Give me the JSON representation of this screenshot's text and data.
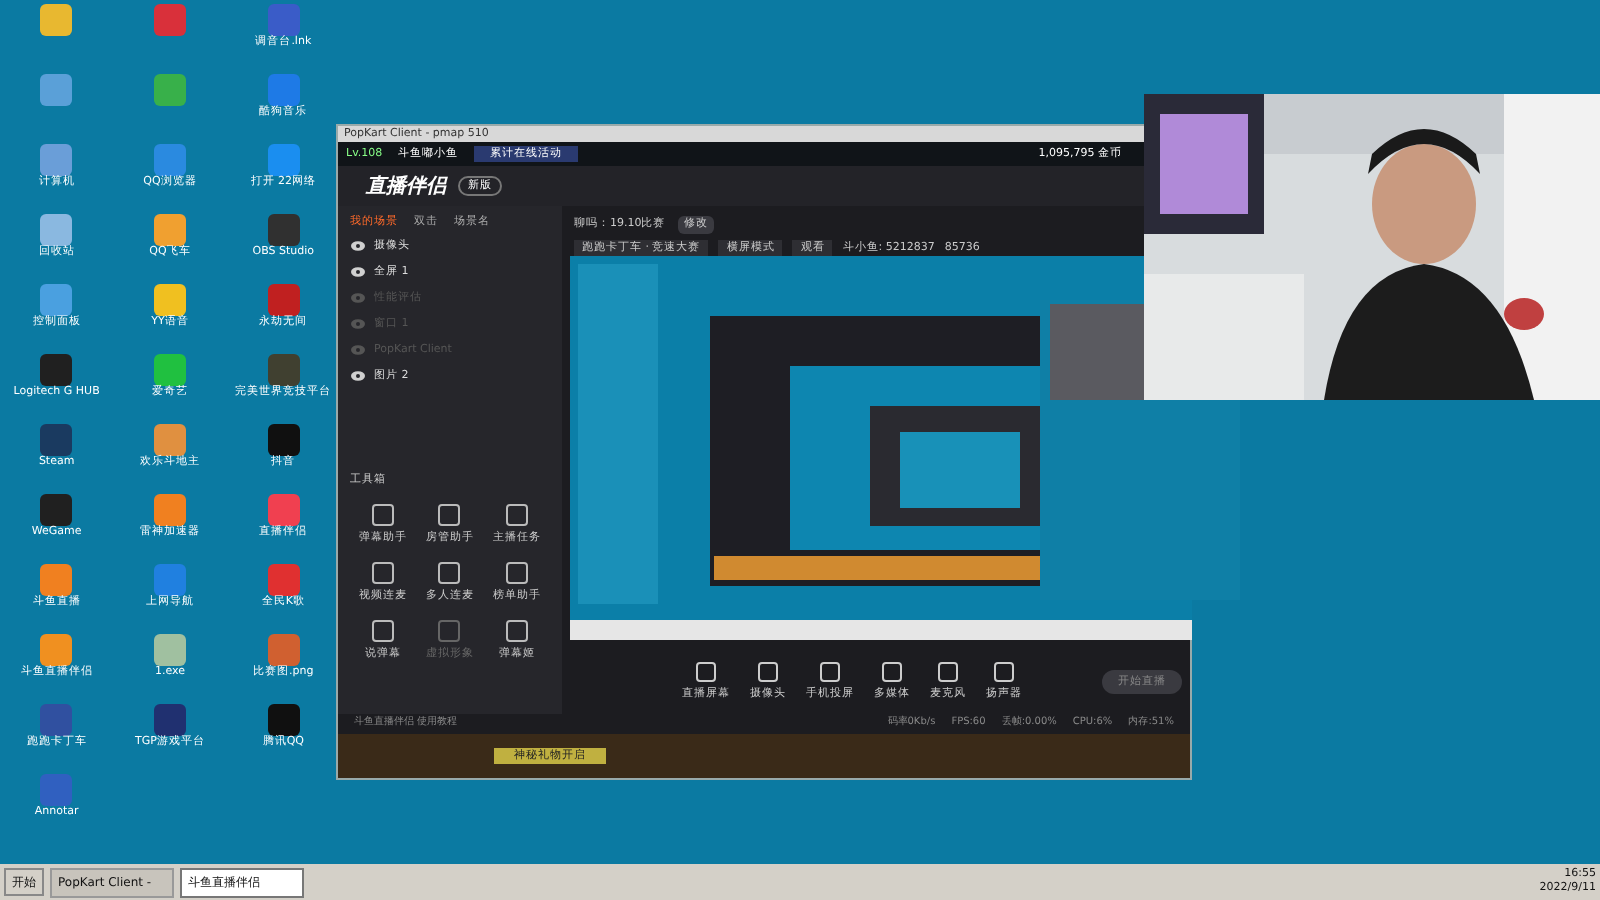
{
  "desktop_icons": [
    {
      "color": "#e8b830"
    },
    {
      "color": "#d9303a"
    },
    {
      "label": "调音台.lnk",
      "color": "#3a5cc8"
    },
    {
      "color": "#5aa0d8"
    },
    {
      "color": "#38b04a"
    },
    {
      "label": "酷狗音乐",
      "color": "#1e7ae6"
    },
    {
      "label": "计算机",
      "color": "#6a9ed8"
    },
    {
      "label": "QQ浏览器",
      "color": "#2a8ae0"
    },
    {
      "label": "打开 22网络",
      "color": "#1a8ef0"
    },
    {
      "label": "回收站",
      "color": "#8ab8e0"
    },
    {
      "label": "QQ飞车",
      "color": "#f0a030"
    },
    {
      "label": "OBS Studio",
      "color": "#303030"
    },
    {
      "label": "控制面板",
      "color": "#4aa0e0"
    },
    {
      "label": "YY语音",
      "color": "#f0c020"
    },
    {
      "label": "永劫无间",
      "color": "#c02020"
    },
    {
      "label": "Logitech G HUB",
      "color": "#202020"
    },
    {
      "label": "爱奇艺",
      "color": "#20c040"
    },
    {
      "label": "完美世界竞技平台",
      "color": "#404030"
    },
    {
      "label": "Steam",
      "color": "#1a3a60"
    },
    {
      "label": "欢乐斗地主",
      "color": "#e09040"
    },
    {
      "label": "抖音",
      "color": "#101010"
    },
    {
      "label": "WeGame",
      "color": "#202020"
    },
    {
      "label": "雷神加速器",
      "color": "#f08020"
    },
    {
      "label": "直播伴侣",
      "color": "#f04050"
    },
    {
      "label": "斗鱼直播",
      "color": "#f08020"
    },
    {
      "label": "上网导航",
      "color": "#2080e0"
    },
    {
      "label": "全民K歌",
      "color": "#e03030"
    },
    {
      "label": "斗鱼直播伴侣",
      "color": "#f09020"
    },
    {
      "label": "1.exe",
      "color": "#a0c0a0"
    },
    {
      "label": "比赛图.png",
      "color": "#d06030"
    },
    {
      "label": "跑跑卡丁车",
      "color": "#3050a0"
    },
    {
      "label": "TGP游戏平台",
      "color": "#203070"
    },
    {
      "label": "腾讯QQ",
      "color": "#101010"
    },
    {
      "label": "Annotar",
      "color": "#3060c0"
    }
  ],
  "game_window": {
    "title": "PopKart Client - pmap 510",
    "level": "Lv.108",
    "player": "斗鱼嘟小鱼",
    "event": "累计在线活动",
    "coins": "1,095,795 金币",
    "banner": "神秘礼物开启"
  },
  "app": {
    "logo": "直播伴侣",
    "version_button": "新版",
    "scene_tabs": [
      {
        "label": "我的场景",
        "selected": true
      },
      {
        "label": "双击",
        "selected": false
      },
      {
        "label": "场景名",
        "selected": false
      }
    ],
    "sources": [
      {
        "name": "摄像头",
        "visible": true
      },
      {
        "name": "全屏 1",
        "visible": true
      },
      {
        "name": "性能评估",
        "visible": false
      },
      {
        "name": "窗口 1",
        "visible": false
      },
      {
        "name": "PopKart Client",
        "visible": false
      },
      {
        "name": "图片 2",
        "visible": true
      }
    ],
    "room_title": "聊吗：19.10比赛",
    "edit_button": "修改",
    "category": "跑跑卡丁车 · 竞速大赛",
    "mode": "横屏模式",
    "watch": "观看",
    "room_id": "斗小鱼: 5212837",
    "fans": "85736",
    "toolbox_title": "工具箱",
    "tools": [
      {
        "label": "弹幕助手",
        "disabled": false
      },
      {
        "label": "房管助手",
        "disabled": false
      },
      {
        "label": "主播任务",
        "disabled": false
      },
      {
        "label": "视频连麦",
        "disabled": false
      },
      {
        "label": "多人连麦",
        "disabled": false
      },
      {
        "label": "榜单助手",
        "disabled": false
      },
      {
        "label": "说弹幕",
        "disabled": false
      },
      {
        "label": "虚拟形象",
        "disabled": true
      },
      {
        "label": "弹幕姬",
        "disabled": false
      }
    ],
    "controls": [
      {
        "label": "直播屏幕"
      },
      {
        "label": "摄像头"
      },
      {
        "label": "手机投屏"
      },
      {
        "label": "多媒体"
      },
      {
        "label": "麦克风"
      },
      {
        "label": "扬声器"
      }
    ],
    "start_button": "开始直播",
    "tutorial": "斗鱼直播伴侣 使用教程",
    "stats": [
      "码率0Kb/s",
      "FPS:60",
      "丢帧:0.00%",
      "CPU:6%",
      "内存:51%"
    ]
  },
  "taskbar": {
    "start": "开始",
    "tasks": [
      {
        "label": "PopKart Client -",
        "selected": false
      },
      {
        "label": "斗鱼直播伴侣",
        "selected": true
      }
    ],
    "time": "16:55",
    "date": "2022/9/11"
  }
}
